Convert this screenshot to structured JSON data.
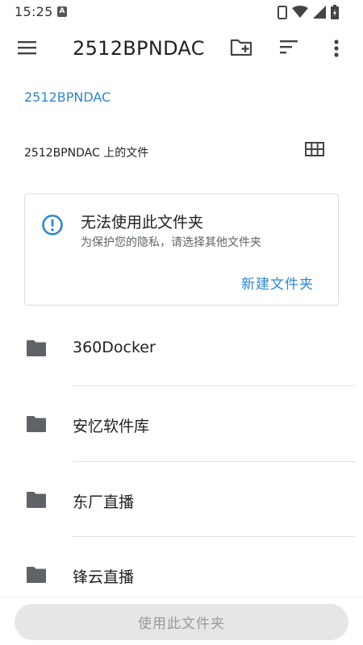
{
  "status_bar": {
    "time": "15:25",
    "notification_badge": "A",
    "icons": [
      "phone-icon",
      "wifi-icon",
      "signal-icon",
      "battery-icon"
    ]
  },
  "app_bar": {
    "title": "2512BPNDAC",
    "icons": [
      "menu-icon",
      "new-folder-icon",
      "sort-icon",
      "more-vert-icon"
    ]
  },
  "breadcrumb": {
    "root": "2512BPNDAC"
  },
  "section": {
    "header": "2512BPNDAC 上的文件",
    "view_toggle_icon": "grid-view-icon"
  },
  "info_card": {
    "icon": "info-icon",
    "title": "无法使用此文件夹",
    "subtitle": "为保护您的隐私，请选择其他文件夹",
    "action_label": "新建文件夹"
  },
  "folders": [
    {
      "name": "360Docker",
      "icon": "folder-icon"
    },
    {
      "name": "安忆软件库",
      "icon": "folder-icon"
    },
    {
      "name": "东厂直播",
      "icon": "folder-icon"
    },
    {
      "name": "锋云直播",
      "icon": "folder-icon"
    }
  ],
  "bottom_bar": {
    "use_folder_label": "使用此文件夹",
    "enabled": false
  },
  "colors": {
    "accent": "#2f86c8",
    "text_primary": "#202124",
    "text_secondary": "#5f6368",
    "icon": "#5f6368",
    "disabled_button_bg": "#e6e6e6",
    "disabled_button_text": "#9a9a9a"
  }
}
